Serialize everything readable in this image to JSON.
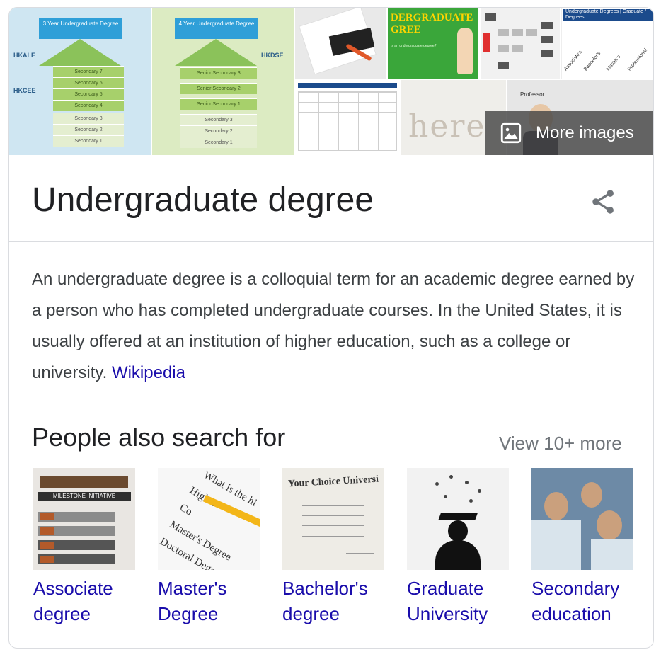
{
  "images": {
    "more_label": "More images",
    "tile1": {
      "caption": "3 Year Undergraduate Degree",
      "left_labels": [
        "HKALE",
        "HKCEE"
      ],
      "bars": [
        "Secondary 7",
        "Secondary 6",
        "Secondary 5",
        "Secondary 4",
        "Secondary 3",
        "Secondary 2",
        "Secondary 1"
      ]
    },
    "tile2": {
      "caption": "4 Year Undergraduate Degree",
      "right_label": "HKDSE",
      "bars": [
        "Senior Secondary 3",
        "Senior Secondary 2",
        "Senior Secondary 1",
        "Secondary 3",
        "Secondary 2",
        "Secondary 1"
      ]
    },
    "tile4": {
      "heading": "DERGRADUATE\nGREE",
      "body": "Is an undergraduate degree?"
    },
    "tile6": {
      "header": "Undergraduate Degrees | Graduate / Degrees",
      "diagonals": [
        "Associate's",
        "Bachelor's",
        "Master's",
        "Professional"
      ]
    },
    "tile8": {
      "handwriting": "here"
    },
    "tile9": {
      "caption": "Professor"
    }
  },
  "entity": {
    "title": "Undergraduate degree",
    "description": "An undergraduate degree is a colloquial term for an academic degree earned by a person who has completed undergraduate courses. In the United States, it is usually offered at an institution of higher education, such as a college or university.",
    "source_link": "Wikipedia"
  },
  "people_also_search": {
    "heading": "People also search for",
    "view_more": "View 10+ more",
    "items": [
      {
        "label": "Associate degree",
        "thumb_text": "MILESTONE INITIATIVE"
      },
      {
        "label": "Master's Degree",
        "thumb_lines": [
          "What is the hi",
          "High S",
          "Co",
          "Master's Degree",
          "Doctoral Degr"
        ]
      },
      {
        "label": "Bachelor's degree",
        "thumb_text": "Your Choice Universi"
      },
      {
        "label": "Graduate University"
      },
      {
        "label": "Secondary education"
      }
    ]
  },
  "colors": {
    "link": "#1a0dab",
    "title": "#202124",
    "muted": "#70757a",
    "border": "#dadce0"
  },
  "icons": {
    "more_images": "image-icon",
    "share": "share-icon"
  }
}
